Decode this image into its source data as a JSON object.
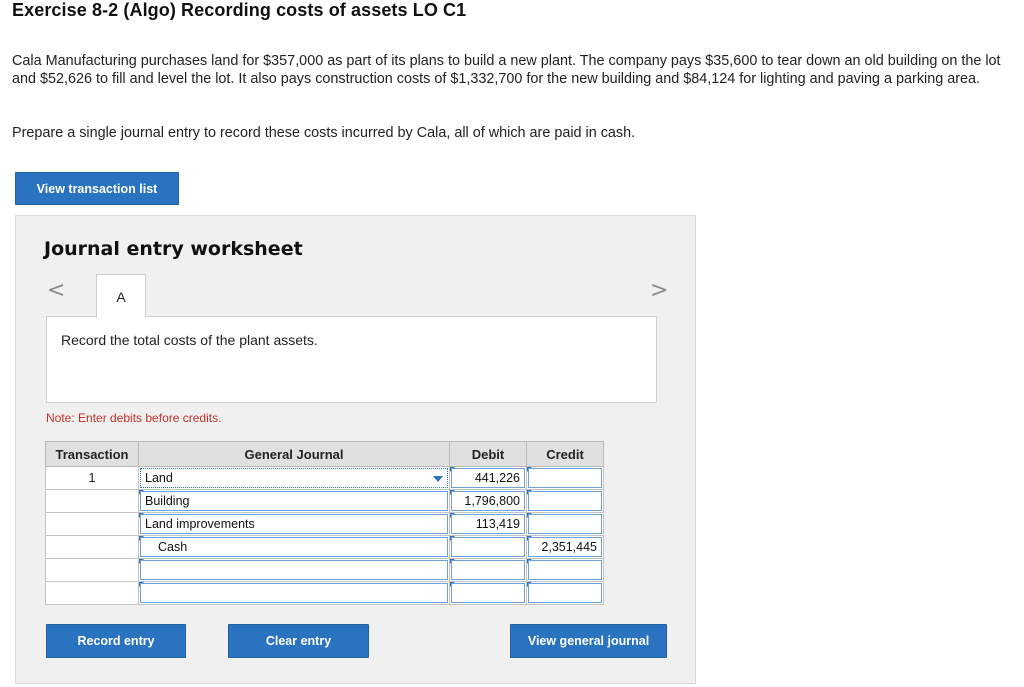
{
  "header": {
    "title": "Exercise 8-2 (Algo) Recording costs of assets LO C1"
  },
  "problem": {
    "paragraph1": "Cala Manufacturing purchases land for $357,000 as part of its plans to build a new plant. The company pays $35,600 to tear down an old building on the lot and $52,626 to fill and level the lot. It also pays construction costs of $1,332,700 for the new building and $84,124 for lighting and paving a parking area.",
    "paragraph2": "Prepare a single journal entry to record these costs incurred by Cala, all of which are paid in cash."
  },
  "buttons": {
    "view_transaction_list": "View transaction list",
    "record_entry": "Record entry",
    "clear_entry": "Clear entry",
    "view_general_journal": "View general journal"
  },
  "worksheet": {
    "title": "Journal entry worksheet",
    "nav_prev": "<",
    "nav_next": ">",
    "tab_label": "A",
    "instruction": "Record the total costs of the plant assets.",
    "note": "Note: Enter debits before credits."
  },
  "journal": {
    "headers": {
      "transaction": "Transaction",
      "general_journal": "General Journal",
      "debit": "Debit",
      "credit": "Credit"
    },
    "rows": [
      {
        "transaction": "1",
        "account": "Land",
        "debit": "441,226",
        "credit": ""
      },
      {
        "transaction": "",
        "account": "Building",
        "debit": "1,796,800",
        "credit": ""
      },
      {
        "transaction": "",
        "account": "Land improvements",
        "debit": "113,419",
        "credit": ""
      },
      {
        "transaction": "",
        "account": "Cash",
        "debit": "",
        "credit": "2,351,445"
      },
      {
        "transaction": "",
        "account": "",
        "debit": "",
        "credit": ""
      },
      {
        "transaction": "",
        "account": "",
        "debit": "",
        "credit": ""
      }
    ]
  },
  "colors": {
    "button_blue": "#2a73c0",
    "note_red": "#c0302a",
    "worksheet_bg": "#f0f0f0"
  }
}
